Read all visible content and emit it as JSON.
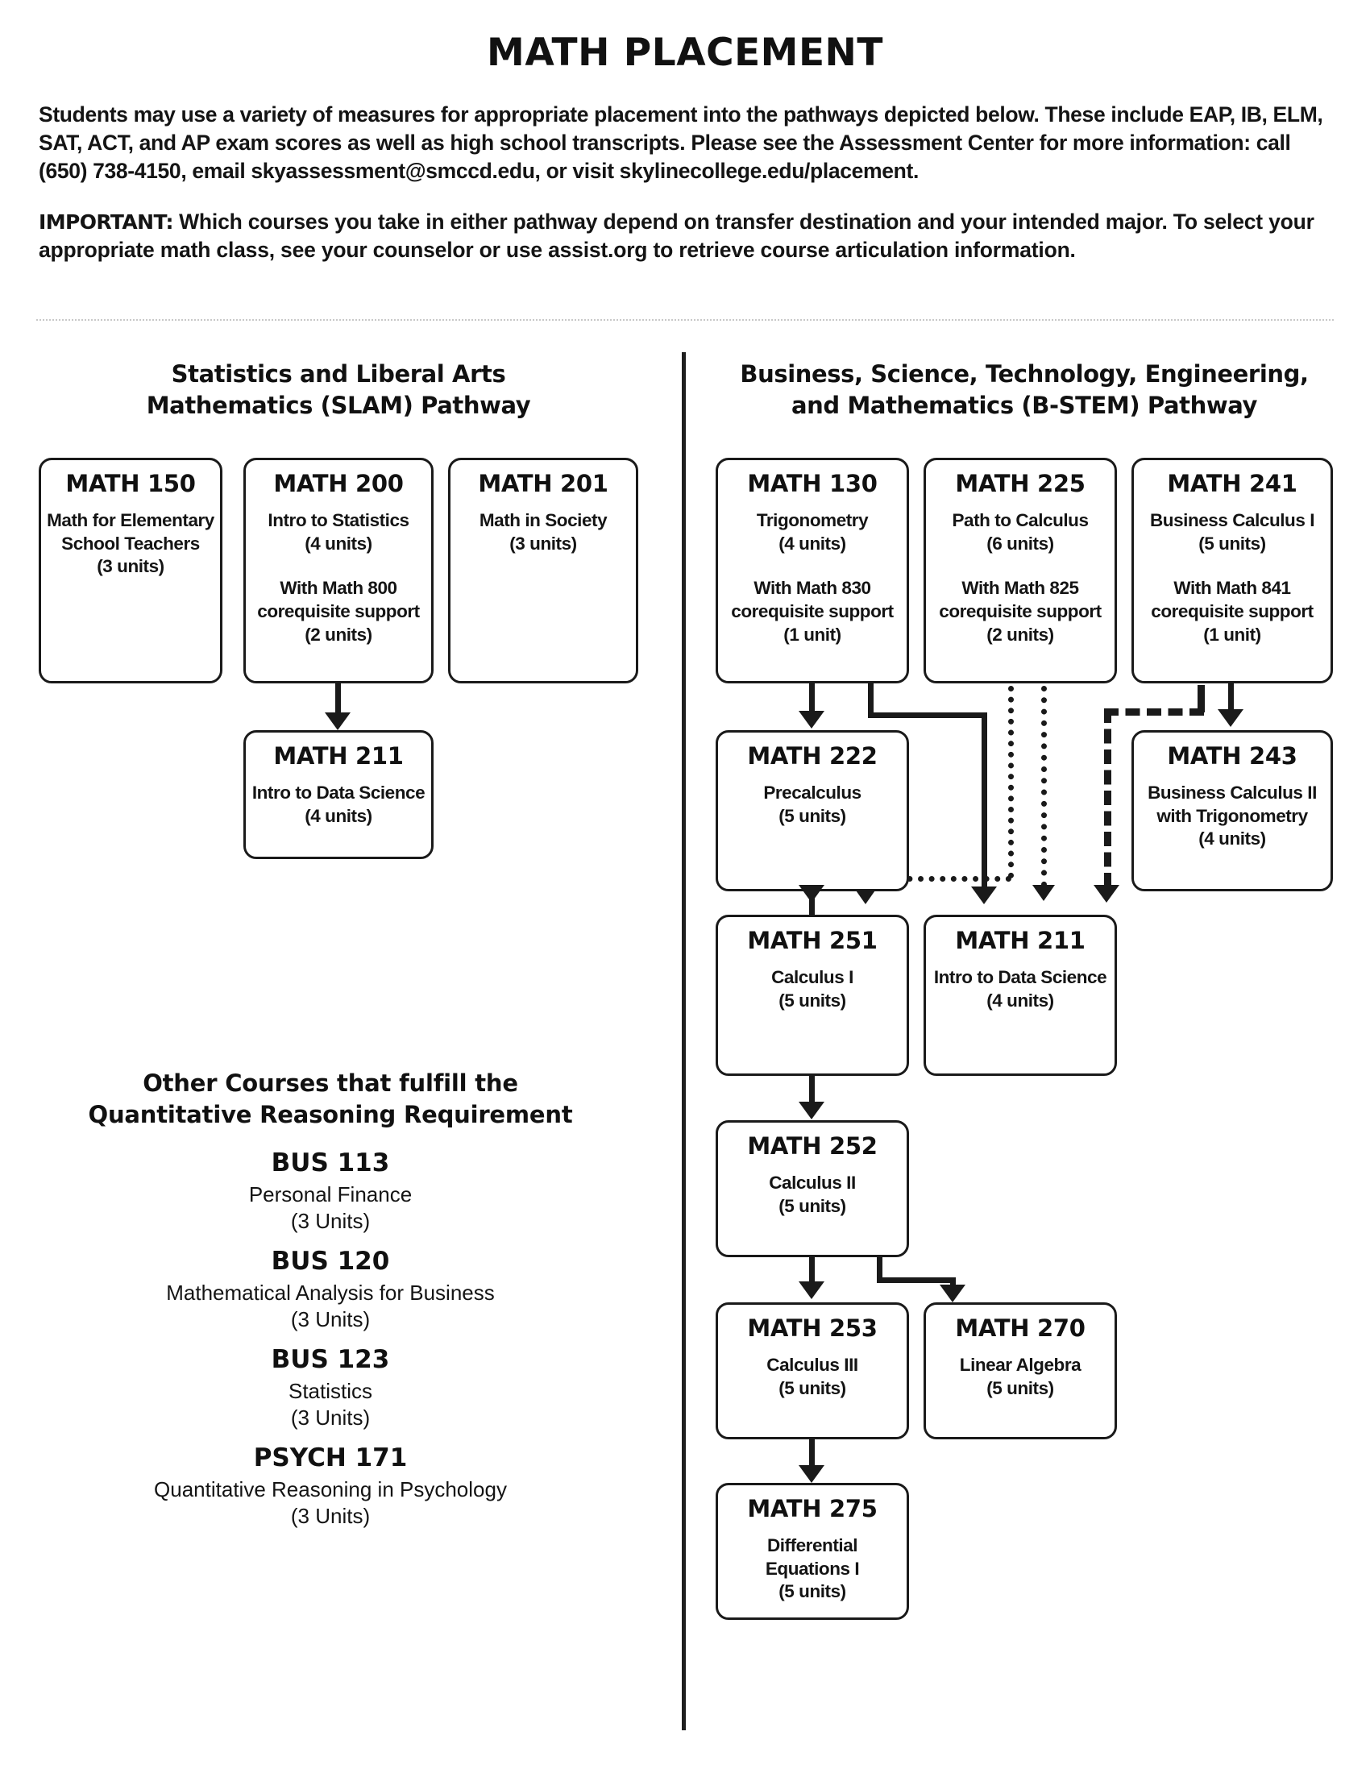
{
  "header": {
    "title": "MATH PLACEMENT",
    "intro": "Students may use a variety of measures for appropriate placement into the pathways depicted below. These include EAP, IB, ELM, SAT, ACT, and AP exam scores as well as high school transcripts. Please see the Assessment Center for more information: call (650) 738-4150, email skyassessment@smccd.edu, or visit skylinecollege.edu/placement.",
    "important_label": "IMPORTANT:",
    "important_text": " Which courses you take in either pathway depend on transfer destination and your intended major. To select your appropriate math class, see your counselor or use assist.org to retrieve course articulation information."
  },
  "slam": {
    "heading": "Statistics and Liberal Arts\nMathematics (SLAM) Pathway",
    "courses": [
      {
        "code": "MATH 150",
        "desc": "Math for Elementary\nSchool Teachers\n(3 units)",
        "coreq": ""
      },
      {
        "code": "MATH 200",
        "desc": "Intro to Statistics\n(4 units)",
        "coreq": "With Math 800\ncorequisite support\n(2 units)"
      },
      {
        "code": "MATH 201",
        "desc": "Math in Society\n(3 units)",
        "coreq": ""
      },
      {
        "code": "MATH 211",
        "desc": "Intro to Data Science\n(4 units)",
        "coreq": ""
      }
    ]
  },
  "bstem": {
    "heading": "Business, Science, Technology, Engineering,\nand Mathematics (B-STEM) Pathway",
    "courses": [
      {
        "code": "MATH 130",
        "desc": "Trigonometry\n(4 units)",
        "coreq": "With Math 830\ncorequisite support\n(1 unit)"
      },
      {
        "code": "MATH 225",
        "desc": "Path to Calculus\n(6 units)",
        "coreq": "With Math 825\ncorequisite support\n(2 units)"
      },
      {
        "code": "MATH 241",
        "desc": "Business Calculus I\n(5 units)",
        "coreq": "With Math 841\ncorequisite support\n(1 unit)"
      },
      {
        "code": "MATH 222",
        "desc": "Precalculus\n(5 units)",
        "coreq": ""
      },
      {
        "code": "MATH 243",
        "desc": "Business Calculus II\nwith Trigonometry\n(4 units)",
        "coreq": ""
      },
      {
        "code": "MATH 251",
        "desc": "Calculus I\n(5 units)",
        "coreq": ""
      },
      {
        "code": "MATH 211",
        "desc": "Intro to Data Science\n(4 units)",
        "coreq": ""
      },
      {
        "code": "MATH 252",
        "desc": "Calculus II\n(5 units)",
        "coreq": ""
      },
      {
        "code": "MATH 253",
        "desc": "Calculus III\n(5 units)",
        "coreq": ""
      },
      {
        "code": "MATH 270",
        "desc": "Linear Algebra\n(5 units)",
        "coreq": ""
      },
      {
        "code": "MATH 275",
        "desc": "Differential Equations I\n(5 units)",
        "coreq": ""
      }
    ]
  },
  "other_courses": {
    "heading": "Other Courses that fulfill the\nQuantitative Reasoning Requirement",
    "items": [
      {
        "code": "BUS 113",
        "name": "Personal Finance",
        "units": "(3 Units)"
      },
      {
        "code": "BUS 120",
        "name": "Mathematical Analysis for Business",
        "units": "(3 Units)"
      },
      {
        "code": "BUS 123",
        "name": "Statistics",
        "units": "(3 Units)"
      },
      {
        "code": "PSYCH 171",
        "name": "Quantitative Reasoning in Psychology",
        "units": "(3 Units)"
      }
    ]
  },
  "colors": {
    "ink": "#1a1a1a",
    "rule": "#c8c8c8",
    "background": "#ffffff"
  }
}
